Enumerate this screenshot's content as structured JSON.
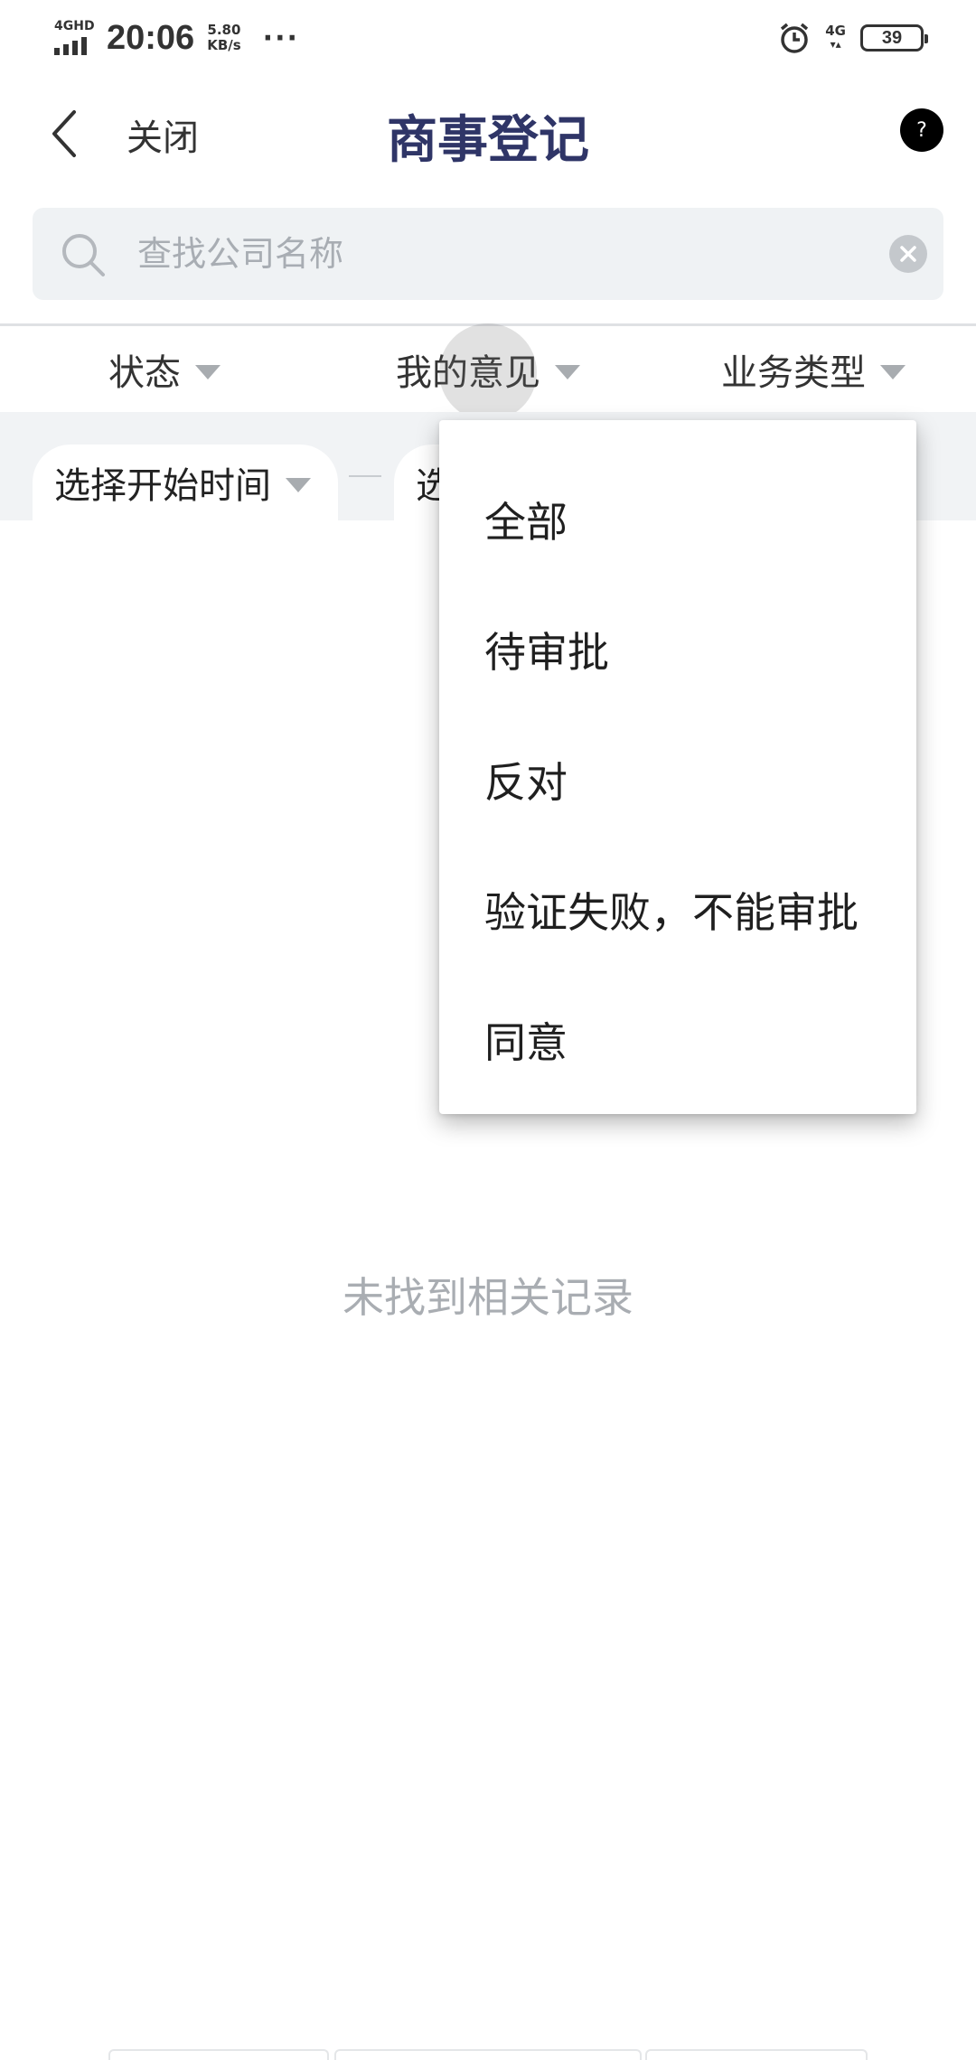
{
  "status_bar": {
    "network": "4GHD",
    "time": "20:06",
    "speed_value": "5.80",
    "speed_unit": "KB/s",
    "more": "···",
    "network_right": "4G",
    "battery": "39"
  },
  "header": {
    "close_label": "关闭",
    "title": "商事登记",
    "help_label": "?"
  },
  "search": {
    "placeholder": "查找公司名称",
    "value": ""
  },
  "filters": [
    {
      "label": "状态"
    },
    {
      "label": "我的意见"
    },
    {
      "label": "业务类型"
    }
  ],
  "date_range": {
    "start_label": "选择开始时间",
    "end_label_partial": "选"
  },
  "dropdown": {
    "items": [
      {
        "label": "全部"
      },
      {
        "label": "待审批"
      },
      {
        "label": "反对"
      },
      {
        "label": "验证失败，不能审批"
      },
      {
        "label": "同意"
      }
    ]
  },
  "empty_state": "未找到相关记录",
  "colors": {
    "title": "#2f3567",
    "search_bg": "#eff2f4",
    "muted_text": "#a9adb2"
  }
}
